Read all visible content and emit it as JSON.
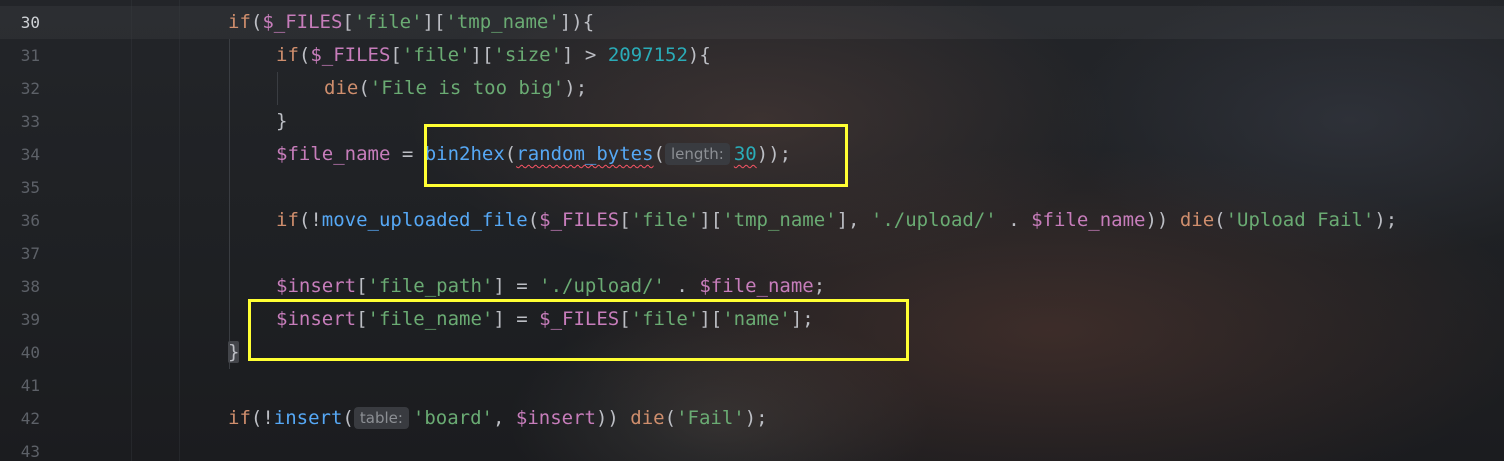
{
  "editor": {
    "line_numbers": [
      "30",
      "31",
      "32",
      "33",
      "34",
      "35",
      "36",
      "37",
      "38",
      "39",
      "40",
      "41",
      "42",
      "43"
    ],
    "active_line": "30",
    "colors": {
      "keyword": "#cf8e6d",
      "function": "#56a8f5",
      "variable": "#c77dbb",
      "string": "#6aab73",
      "number": "#2aacb8",
      "default": "#bcbec4",
      "highlight_box": "#ffff33"
    },
    "lines": {
      "l30": {
        "kw_if": "if",
        "p1": "(",
        "v_files": "$_FILES",
        "p2": "[",
        "s_file": "'file'",
        "p3": "][",
        "s_tmp": "'tmp_name'",
        "p4": "])",
        "brace": "{"
      },
      "l31": {
        "kw_if": "if",
        "p1": "(",
        "v_files": "$_FILES",
        "p2": "[",
        "s_file": "'file'",
        "p3": "][",
        "s_size": "'size'",
        "p4": "] > ",
        "n_size": "2097152",
        "p5": "){"
      },
      "l32": {
        "kw_die": "die",
        "p1": "(",
        "s_msg": "'File is too big'",
        "p2": ");"
      },
      "l33": {
        "brace": "}"
      },
      "l34": {
        "v_name": "$file_name",
        "p1": " = ",
        "f_bin2hex": "bin2hex",
        "p2": "(",
        "f_random": "random_bytes",
        "p3": "(",
        "hint": "length:",
        "n_len": "30",
        "p4": "));"
      },
      "l36": {
        "kw_if": "if",
        "p1": "(!",
        "f_move": "move_uploaded_file",
        "p2": "(",
        "v_files": "$_FILES",
        "p3": "[",
        "s_file": "'file'",
        "p4": "][",
        "s_tmp": "'tmp_name'",
        "p5": "], ",
        "s_path": "'./upload/'",
        "p6": " . ",
        "v_name": "$file_name",
        "p7": ")) ",
        "kw_die": "die",
        "p8": "(",
        "s_fail": "'Upload Fail'",
        "p9": ");"
      },
      "l38": {
        "v_insert": "$insert",
        "p1": "[",
        "s_key": "'file_path'",
        "p2": "] = ",
        "s_path": "'./upload/'",
        "p3": " . ",
        "v_name": "$file_name",
        "p4": ";"
      },
      "l39": {
        "v_insert": "$insert",
        "p1": "[",
        "s_key": "'file_name'",
        "p2": "] = ",
        "v_files": "$_FILES",
        "p3": "[",
        "s_file": "'file'",
        "p4": "][",
        "s_name": "'name'",
        "p5": "];"
      },
      "l40": {
        "brace": "}"
      },
      "l42": {
        "kw_if": "if",
        "p1": "(!",
        "f_insert": "insert",
        "p2": "(",
        "hint": "table:",
        "s_board": "'board'",
        "p3": ", ",
        "v_insert": "$insert",
        "p4": ")) ",
        "kw_die": "die",
        "p5": "(",
        "s_fail": "'Fail'",
        "p6": ");"
      }
    }
  }
}
